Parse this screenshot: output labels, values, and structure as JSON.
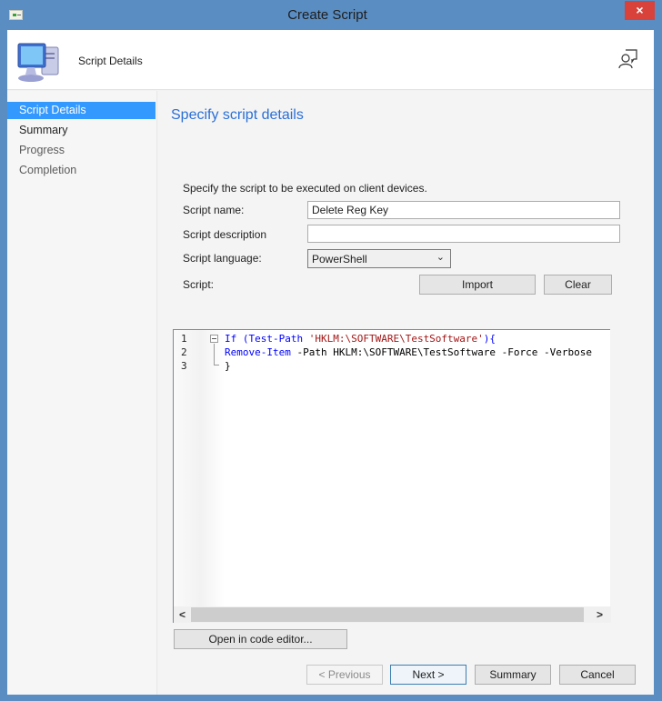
{
  "window": {
    "title": "Create Script",
    "close_label": "×"
  },
  "header": {
    "title": "Script Details"
  },
  "sidebar": {
    "items": [
      {
        "label": "Script Details",
        "active": true
      },
      {
        "label": "Summary",
        "active": false
      },
      {
        "label": "Progress",
        "active": false
      },
      {
        "label": "Completion",
        "active": false
      }
    ]
  },
  "content": {
    "page_title": "Specify script details",
    "intro": "Specify the script to be executed on client devices.",
    "fields": {
      "script_name_label": "Script name:",
      "script_name_value": "Delete Reg Key",
      "script_description_label": "Script description",
      "script_description_value": "",
      "script_language_label": "Script language:",
      "script_language_value": "PowerShell",
      "script_label": "Script:"
    },
    "buttons": {
      "import": "Import",
      "clear": "Clear",
      "open_editor": "Open in code editor..."
    },
    "editor": {
      "line_numbers": [
        "1",
        "2",
        "3"
      ],
      "lines": [
        {
          "parts": [
            {
              "text": "If",
              "cls": "kw"
            },
            {
              "text": " (",
              "cls": "kw"
            },
            {
              "text": "Test-Path",
              "cls": "cmd"
            },
            {
              "text": " ",
              "cls": ""
            },
            {
              "text": "'HKLM:\\SOFTWARE\\TestSoftware'",
              "cls": "str"
            },
            {
              "text": "){",
              "cls": "kw"
            }
          ]
        },
        {
          "parts": [
            {
              "text": "Remove-Item",
              "cls": "cmd"
            },
            {
              "text": " -Path HKLM:\\SOFTWARE\\TestSoftware -Force -Verbose",
              "cls": ""
            }
          ]
        },
        {
          "parts": [
            {
              "text": "}",
              "cls": ""
            }
          ]
        }
      ],
      "scroll_left": "<",
      "scroll_right": ">"
    }
  },
  "footer": {
    "previous": "< Previous",
    "next": "Next >",
    "summary": "Summary",
    "cancel": "Cancel"
  }
}
